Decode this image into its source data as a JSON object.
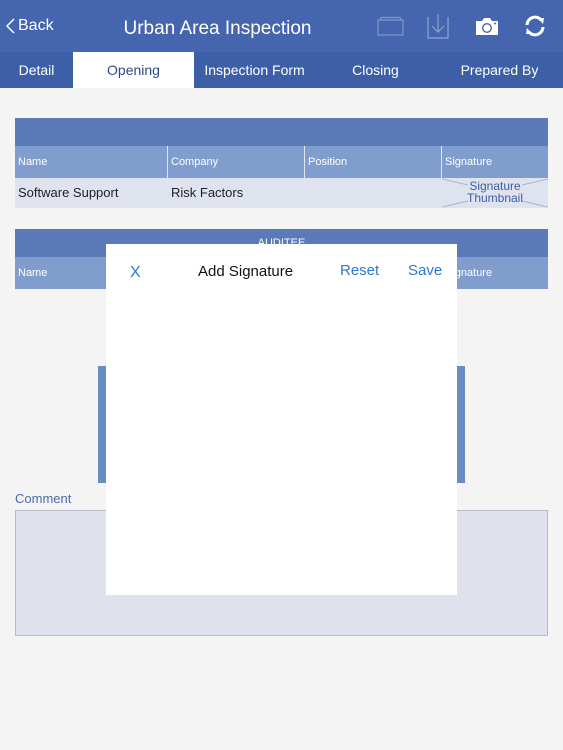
{
  "navbar": {
    "back_label": "Back",
    "title": "Urban Area Inspection",
    "icons": [
      "folder-icon",
      "download-icon",
      "camera-icon",
      "sync-icon"
    ]
  },
  "tabs": [
    {
      "label": "Detail",
      "active": false
    },
    {
      "label": "Opening",
      "active": true
    },
    {
      "label": "Inspection Form",
      "active": false
    },
    {
      "label": "Closing",
      "active": false
    },
    {
      "label": "Prepared By",
      "active": false
    }
  ],
  "auditor_table": {
    "title": "",
    "columns": [
      "Name",
      "Company",
      "Position",
      "Signature"
    ],
    "rows": [
      {
        "name": "Software Support",
        "company": "Risk Factors",
        "position": "",
        "signature": "Signature Thumbnail"
      }
    ]
  },
  "auditee_table": {
    "title": "AUDITEE",
    "columns": [
      "Name",
      "Signature"
    ]
  },
  "comment": {
    "label": "Comment",
    "value": ""
  },
  "dialog": {
    "close_label": "X",
    "title": "Add Signature",
    "reset_label": "Reset",
    "save_label": "Save"
  },
  "colors": {
    "navbar": "#4566ae",
    "tabbar": "#3d5fa8",
    "table_header": "#5a7ab8",
    "column_header": "#819dce",
    "row_bg": "#dfe3ee",
    "link": "#2e78d0"
  }
}
